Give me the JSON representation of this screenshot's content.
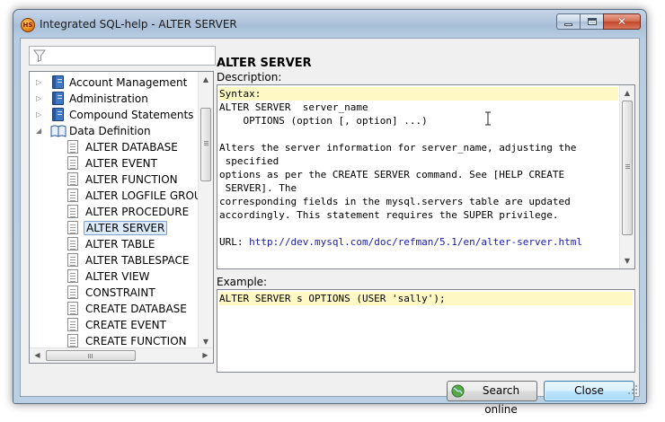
{
  "window": {
    "title": "Integrated SQL-help - ALTER SERVER",
    "app_icon_text": "HS",
    "icons": {
      "app": "app-icon",
      "minimize": "minimize-icon",
      "maximize": "maximize-icon",
      "close": "close-icon"
    }
  },
  "search": {
    "value": "",
    "placeholder": "",
    "icon": "filter-icon"
  },
  "tree": {
    "items": [
      {
        "label": "Account Management",
        "type": "book",
        "expanded": false
      },
      {
        "label": "Administration",
        "type": "book",
        "expanded": false
      },
      {
        "label": "Compound Statements",
        "type": "book",
        "expanded": false
      },
      {
        "label": "Data Definition",
        "type": "book",
        "expanded": true
      },
      {
        "label": "ALTER DATABASE",
        "type": "page"
      },
      {
        "label": "ALTER EVENT",
        "type": "page"
      },
      {
        "label": "ALTER FUNCTION",
        "type": "page"
      },
      {
        "label": "ALTER LOGFILE GROUP",
        "type": "page"
      },
      {
        "label": "ALTER PROCEDURE",
        "type": "page"
      },
      {
        "label": "ALTER SERVER",
        "type": "page",
        "selected": true
      },
      {
        "label": "ALTER TABLE",
        "type": "page"
      },
      {
        "label": "ALTER TABLESPACE",
        "type": "page"
      },
      {
        "label": "ALTER VIEW",
        "type": "page"
      },
      {
        "label": "CONSTRAINT",
        "type": "page"
      },
      {
        "label": "CREATE DATABASE",
        "type": "page"
      },
      {
        "label": "CREATE EVENT",
        "type": "page"
      },
      {
        "label": "CREATE FUNCTION",
        "type": "page"
      }
    ]
  },
  "topic": {
    "title": "ALTER SERVER",
    "description_label": "Description:",
    "description_lines": [
      "Syntax:",
      "ALTER SERVER  server_name",
      "    OPTIONS (option [, option] ...)",
      "",
      "Alters the server information for server_name, adjusting the",
      " specified",
      "options as per the CREATE SERVER command. See [HELP CREATE",
      " SERVER]. The",
      "corresponding fields in the mysql.servers table are updated",
      "accordingly. This statement requires the SUPER privilege.",
      ""
    ],
    "url_prefix": "URL: ",
    "url": "http://dev.mysql.com/doc/refman/5.1/en/alter-server.html",
    "example_label": "Example:",
    "example_code": "ALTER SERVER s OPTIONS (USER 'sally');"
  },
  "buttons": {
    "search_online": "Search online",
    "close": "Close"
  },
  "colors": {
    "highlight": "#fdf8c4",
    "link": "#1a1aa6",
    "selection": "#dcebfc"
  }
}
